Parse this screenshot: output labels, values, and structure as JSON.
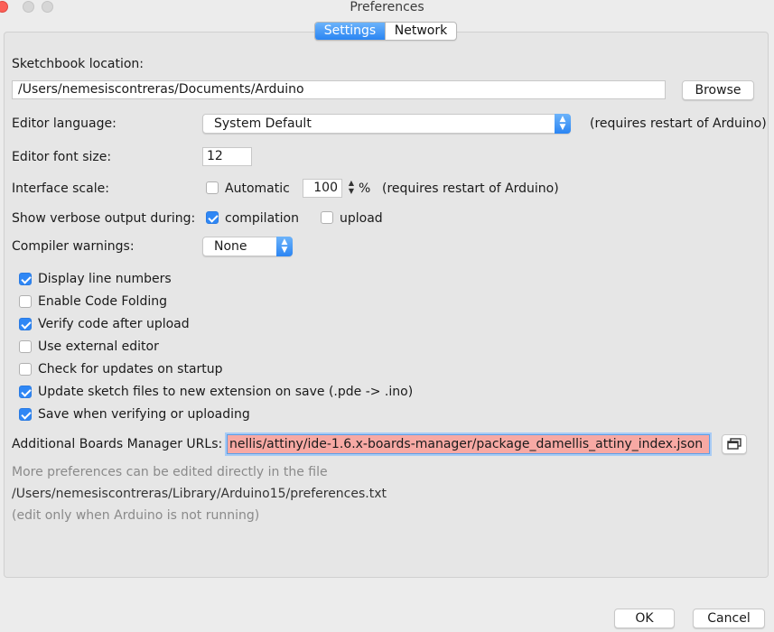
{
  "window": {
    "title": "Preferences"
  },
  "tabs": [
    {
      "label": "Settings",
      "active": true
    },
    {
      "label": "Network",
      "active": false
    }
  ],
  "sketchbook": {
    "label": "Sketchbook location:",
    "path": "/Users/nemesiscontreras/Documents/Arduino",
    "browse_label": "Browse"
  },
  "editor_language": {
    "label": "Editor language:",
    "value": "System Default",
    "note": "(requires restart of Arduino)"
  },
  "editor_font_size": {
    "label": "Editor font size:",
    "value": "12"
  },
  "interface_scale": {
    "label": "Interface scale:",
    "automatic_label": "Automatic",
    "automatic_checked": false,
    "value": "100",
    "unit": "%",
    "note": "(requires restart of Arduino)"
  },
  "verbose": {
    "label": "Show verbose output during:",
    "compilation_label": "compilation",
    "compilation_checked": true,
    "upload_label": "upload",
    "upload_checked": false
  },
  "compiler_warnings": {
    "label": "Compiler warnings:",
    "value": "None"
  },
  "options": [
    {
      "label": "Display line numbers",
      "checked": true
    },
    {
      "label": "Enable Code Folding",
      "checked": false
    },
    {
      "label": "Verify code after upload",
      "checked": true
    },
    {
      "label": "Use external editor",
      "checked": false
    },
    {
      "label": "Check for updates on startup",
      "checked": false
    },
    {
      "label": "Update sketch files to new extension on save (.pde -> .ino)",
      "checked": true
    },
    {
      "label": "Save when verifying or uploading",
      "checked": true
    }
  ],
  "boards_manager": {
    "label": "Additional Boards Manager URLs:",
    "value": "nellis/attiny/ide-1.6.x-boards-manager/package_damellis_attiny_index.json"
  },
  "footer": {
    "more_prefs": "More preferences can be edited directly in the file",
    "prefs_path": "/Users/nemesiscontreras/Library/Arduino15/preferences.txt",
    "edit_note": "(edit only when Arduino is not running)"
  },
  "buttons": {
    "ok": "OK",
    "cancel": "Cancel"
  },
  "colors": {
    "accent": "#2f87f5",
    "url_field_error": "#f7a9a4",
    "close_button": "#fc5f57"
  }
}
